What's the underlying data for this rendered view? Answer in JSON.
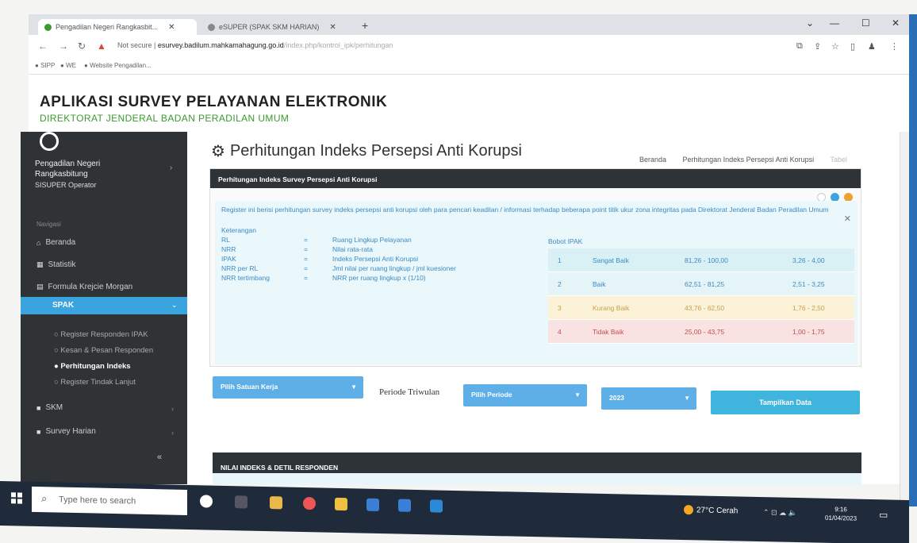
{
  "browser": {
    "tabs": [
      {
        "label": "Pengadilan Negeri Rangkasbit..."
      },
      {
        "label": "eSUPER (SPAK SKM HARIAN)"
      }
    ],
    "address": {
      "security": "Not secure",
      "host": "esurvey.badilum.mahkamahagung.go.id",
      "path": "/index.php/kontrol_ipk/perhitungan"
    },
    "bookmarks": [
      "SIPP",
      "WE",
      "Website Pengadilan..."
    ]
  },
  "app": {
    "title": "APLIKASI SURVEY PELAYANAN ELEKTRONIK",
    "subtitle": "DIREKTORAT JENDERAL BADAN PERADILAN UMUM"
  },
  "sidebar": {
    "user_name_line1": "Pengadilan Negeri",
    "user_name_line2": "Rangkasbitung",
    "user_role": "SISUPER Operator",
    "nav_header": "Navigasi",
    "items": [
      {
        "label": "Beranda",
        "icon": "home-icon"
      },
      {
        "label": "Statistik",
        "icon": "chart-icon"
      },
      {
        "label": "Formula Krejcie Morgan",
        "icon": "calculator-icon"
      }
    ],
    "active_group": "SPAK",
    "sub_items": [
      {
        "label": "Register Responden IPAK"
      },
      {
        "label": "Kesan & Pesan Responden"
      },
      {
        "label": "Perhitungan Indeks"
      },
      {
        "label": "Register Tindak Lanjut"
      }
    ],
    "groups_after": [
      {
        "label": "SKM"
      },
      {
        "label": "Survey Harian"
      }
    ]
  },
  "page": {
    "title": "Perhitungan Indeks Persepsi Anti Korupsi",
    "breadcrumb": [
      "Beranda",
      "Perhitungan Indeks Persepsi Anti Korupsi",
      "Tabel"
    ]
  },
  "panel": {
    "header": "Perhitungan Indeks Survey Persepsi Anti Korupsi",
    "note": "Register ini berisi perhitungan survey indeks persepsi anti korupsi oleh para pencari keadilan / informasi terhadap beberapa point titik ukur zona integritas pada Direktorat Jenderal Badan Peradilan Umum",
    "keterangan_title": "Keterangan",
    "keterangan": [
      {
        "term": "RL",
        "def": "Ruang Lingkup Pelayanan"
      },
      {
        "term": "NRR",
        "def": "Nilai rata-rata"
      },
      {
        "term": "IPAK",
        "def": "Indeks Persepsi Anti Korupsi"
      },
      {
        "term": "NRR per RL",
        "def": "Jml nilai per ruang lingkup / jml kuesioner"
      },
      {
        "term": "NRR tertimbang",
        "def": "NRR per ruang lingkup x (1/10)"
      }
    ],
    "bobot_title": "Bobot IPAK",
    "bobot": [
      {
        "no": "1",
        "label": "Sangat Baik",
        "range": "81,26 - 100,00",
        "score": "3,26 - 4,00",
        "bg": "#d9f0f4",
        "fg": "#3b8bc6"
      },
      {
        "no": "2",
        "label": "Baik",
        "range": "62,51 - 81,25",
        "score": "2,51 - 3,25",
        "bg": "#e4f4f7",
        "fg": "#3b8bc6"
      },
      {
        "no": "3",
        "label": "Kurang Baik",
        "range": "43,76 - 62,50",
        "score": "1,76 - 2,50",
        "bg": "#fbf2d8",
        "fg": "#c8a04a"
      },
      {
        "no": "4",
        "label": "Tidak Baik",
        "range": "25,00 - 43,75",
        "score": "1,00 - 1,75",
        "bg": "#f8e2e2",
        "fg": "#c94b4b"
      }
    ]
  },
  "filters": {
    "satker_placeholder": "Pilih Satuan Kerja",
    "periode_label": "Periode Triwulan",
    "periode_placeholder": "Pilih Periode",
    "year": "2023",
    "submit_label": "Tampilkan Data"
  },
  "results": {
    "header": "NILAI INDEKS & DETIL RESPONDEN"
  },
  "taskbar": {
    "search_placeholder": "Type here to search",
    "weather": "27°C Cerah",
    "time": "9:16",
    "date": "01/04/2023"
  },
  "colors": {
    "accent": "#3aa4df",
    "sidebar": "#2f3336",
    "brand_green": "#3a9a2e"
  }
}
